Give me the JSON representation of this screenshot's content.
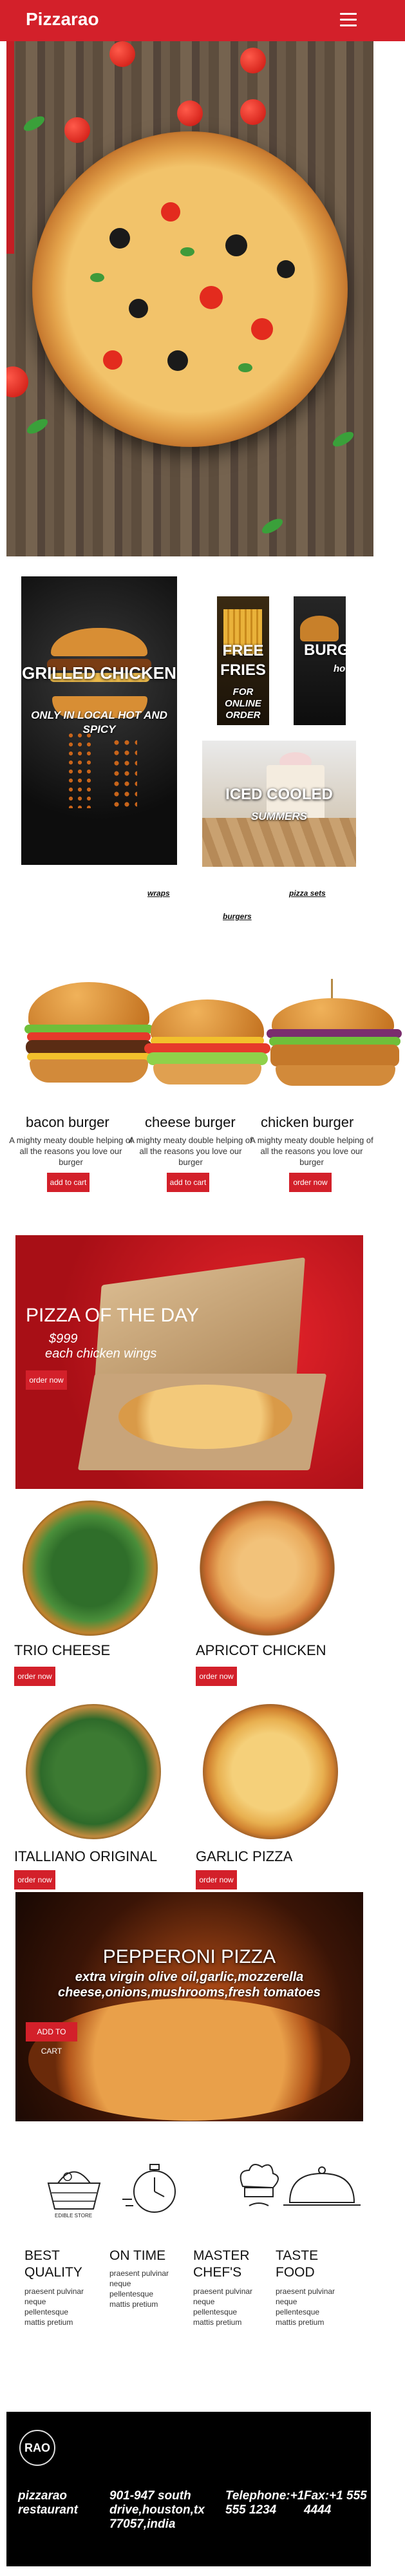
{
  "navbar": {
    "brand": "Pizzarao",
    "menu_icon": "hamburger-menu-icon",
    "color": "#d3202a"
  },
  "hero": {
    "overlay_text": ""
  },
  "categories": {
    "grilled": {
      "title": "GRILLED CHICKEN",
      "subtitle": "ONLY IN LOCAL HOT AND SPICY"
    },
    "free_fries": {
      "title": "FREE FRIES",
      "subtitle": "FOR ONLINE ORDER"
    },
    "burgers_card": {
      "title": "BURG",
      "subtitle": "ho"
    },
    "iced": {
      "title": "ICED COOLED",
      "subtitle": "SUMMERS"
    },
    "links": [
      "wraps",
      "pizza sets",
      "burgers"
    ]
  },
  "burgers": [
    {
      "name": "bacon burger",
      "desc": "A mighty meaty double helping of all the reasons you love our burger",
      "button": "add to cart"
    },
    {
      "name": "cheese burger",
      "desc": "A mighty meaty double helping of all the reasons you love our burger",
      "button": "add to cart"
    },
    {
      "name": "chicken burger",
      "desc": "A mighty meaty double helping of all the reasons you love our burger",
      "button": "order now"
    }
  ],
  "pizza_of_day": {
    "title": "PIZZA OF THE DAY",
    "price": "$999",
    "deal": "each  chicken wings",
    "button": "order now"
  },
  "pizzas": [
    {
      "name": "TRIO CHEESE",
      "button": "order now"
    },
    {
      "name": "APRICOT CHICKEN",
      "button": "order now"
    },
    {
      "name": "ITALLIANO ORIGINAL",
      "button": "order now"
    },
    {
      "name": "GARLIC PIZZA",
      "button": "order now"
    }
  ],
  "pepperoni": {
    "title": "PEPPERONI PIZZA",
    "desc": "extra virgin olive oil,garlic,mozzerella cheese,onions,mushrooms,fresh tomatoes",
    "button": "ADD TO CART"
  },
  "features": [
    {
      "title": "BEST QUALITY",
      "desc": "praesent pulvinar neque pellentesque mattis pretium",
      "icon": "basket-icon",
      "icon_caption": "EDIBLE STORE"
    },
    {
      "title": "ON TIME",
      "desc": "praesent pulvinar neque pellentesque mattis pretium",
      "icon": "stopwatch-icon"
    },
    {
      "title": "MASTER CHEF'S",
      "desc": "praesent pulvinar neque pellentesque mattis pretium",
      "icon": "chef-hat-icon"
    },
    {
      "title": "TASTE FOOD",
      "desc": "praesent pulvinar neque pellentesque mattis pretium",
      "icon": "cloche-icon"
    }
  ],
  "footer": {
    "logo_text": "RAO",
    "company": "pizzarao restaurant",
    "address": "901-947 south drive,houston,tx 77057,india",
    "telephone": "Telephone:+1 555 1234",
    "fax": "Fax:+1 555 4444"
  }
}
